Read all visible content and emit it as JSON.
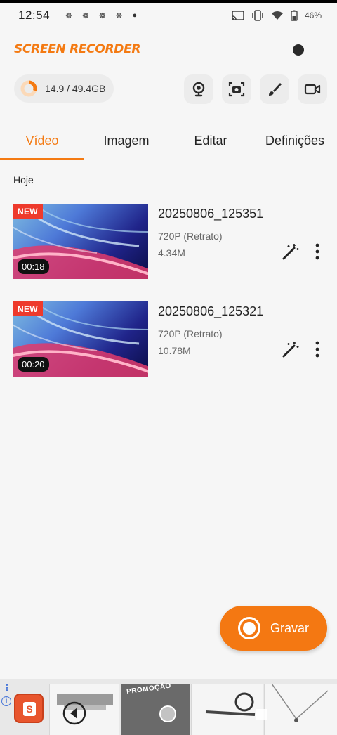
{
  "status_bar": {
    "time": "12:54",
    "battery": "46%"
  },
  "header": {
    "brand": "SCREEN RECORDER"
  },
  "storage": {
    "label": "14.9 / 49.4GB",
    "used_fraction": 0.3
  },
  "tools": [
    {
      "icon": "webcam-icon"
    },
    {
      "icon": "screenshot-icon"
    },
    {
      "icon": "brush-icon"
    },
    {
      "icon": "video-camera-icon"
    }
  ],
  "tabs": [
    {
      "label": "Vídeo",
      "active": true
    },
    {
      "label": "Imagem",
      "active": false
    },
    {
      "label": "Editar",
      "active": false
    },
    {
      "label": "Definições",
      "active": false
    }
  ],
  "section": {
    "title": "Hoje"
  },
  "videos": [
    {
      "badge": "NEW",
      "duration": "00:18",
      "name": "20250806_125351",
      "resolution": "720P (Retrato)",
      "size": "4.34M"
    },
    {
      "badge": "NEW",
      "duration": "00:20",
      "name": "20250806_125321",
      "resolution": "720P (Retrato)",
      "size": "10.78M"
    }
  ],
  "record_button": {
    "label": "Gravar"
  },
  "ad": {
    "promo_text": "PROMOÇÃO",
    "shop_letter": "S"
  },
  "colors": {
    "accent": "#f47a12",
    "badge": "#ee3a2c"
  }
}
